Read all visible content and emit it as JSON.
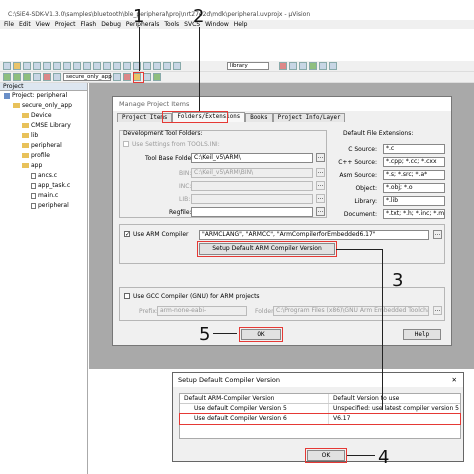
{
  "window": {
    "title": "C:\\SiE4-SDK-V1.3.0\\samples\\bluetooth\\ble_peripheral\\proj\\nrt27e2d\\mdk\\peripheral.uvprojx - µVision"
  },
  "menubar": [
    "File",
    "Edit",
    "View",
    "Project",
    "Flash",
    "Debug",
    "Peripherals",
    "Tools",
    "SVCS",
    "Window",
    "Help"
  ],
  "toolbar": {
    "target_combo": "secure_only_app",
    "library_combo": "library"
  },
  "project_panel": {
    "header": "Project",
    "tree": [
      {
        "label": "Project: peripheral",
        "indent": 0,
        "kind": "project"
      },
      {
        "label": "secure_only_app",
        "indent": 1,
        "kind": "folder"
      },
      {
        "label": "Device",
        "indent": 2,
        "kind": "folder"
      },
      {
        "label": "CMSE Library",
        "indent": 2,
        "kind": "folder"
      },
      {
        "label": "lib",
        "indent": 2,
        "kind": "folder"
      },
      {
        "label": "peripheral",
        "indent": 2,
        "kind": "folder"
      },
      {
        "label": "profile",
        "indent": 2,
        "kind": "folder"
      },
      {
        "label": "app",
        "indent": 2,
        "kind": "folder"
      },
      {
        "label": "ancs.c",
        "indent": 3,
        "kind": "file"
      },
      {
        "label": "app_task.c",
        "indent": 3,
        "kind": "file"
      },
      {
        "label": "main.c",
        "indent": 3,
        "kind": "file"
      },
      {
        "label": "peripheral",
        "indent": 3,
        "kind": "file"
      }
    ]
  },
  "manage_dialog": {
    "title": "Manage Project Items",
    "tabs": [
      "Project Items",
      "Folders/Extensions",
      "Books",
      "Project Info/Layer"
    ],
    "dev_tool_folders": "Development Tool Folders:",
    "use_settings": "Use Settings from TOOLS.INI:",
    "tool_base_folder_label": "Tool Base Folder:",
    "tool_base_folder_value": "C:\\Keil_v5\\ARM\\",
    "bin_label": "BIN:",
    "bin_value": "C:\\Keil_v5\\ARM\\BIN\\",
    "inc_label": "INC:",
    "lib_label": "LIB:",
    "regfile_label": "Regfile:",
    "default_ext_title": "Default File Extensions:",
    "ext_labels": [
      "C Source:",
      "C++ Source:",
      "Asm Source:",
      "Object:",
      "Library:",
      "Document:"
    ],
    "ext_values": [
      "*.c",
      "*.cpp; *.cc; *.cxx",
      "*.s; *.src; *.a*",
      "*.obj; *.o",
      "*.lib",
      "*.txt; *.h; *.inc; *.md"
    ],
    "use_arm_compiler": "Use ARM Compiler",
    "arm_compiler_value": "\"ARMCLANG\", \"ARMCC\", \"ArmCompilerforEmbedded6.17\"",
    "setup_button": "Setup Default ARM Compiler Version",
    "use_gcc": "Use GCC Compiler (GNU) for ARM projects",
    "prefix_label": "Prefix:",
    "prefix_value": "arm-none-eabi-",
    "folder_label": "Folder:",
    "folder_value": "C:\\Program Files (x86)\\GNU Arm Embedded Toolchain\\10 202",
    "ok": "OK",
    "help": "Help"
  },
  "compiler_dialog": {
    "title": "Setup Default Compiler Version",
    "col1": "Default ARM-Compiler Version",
    "col2": "Default Version to use",
    "rows": [
      {
        "c1": "Use default Compiler Version 5",
        "c2": "Unspecified: use latest compiler version 5"
      },
      {
        "c1": "Use default Compiler Version 6",
        "c2": "V6.17"
      }
    ],
    "ok": "OK",
    "close": "✕"
  },
  "callouts": [
    "1",
    "2",
    "3",
    "4",
    "5"
  ]
}
